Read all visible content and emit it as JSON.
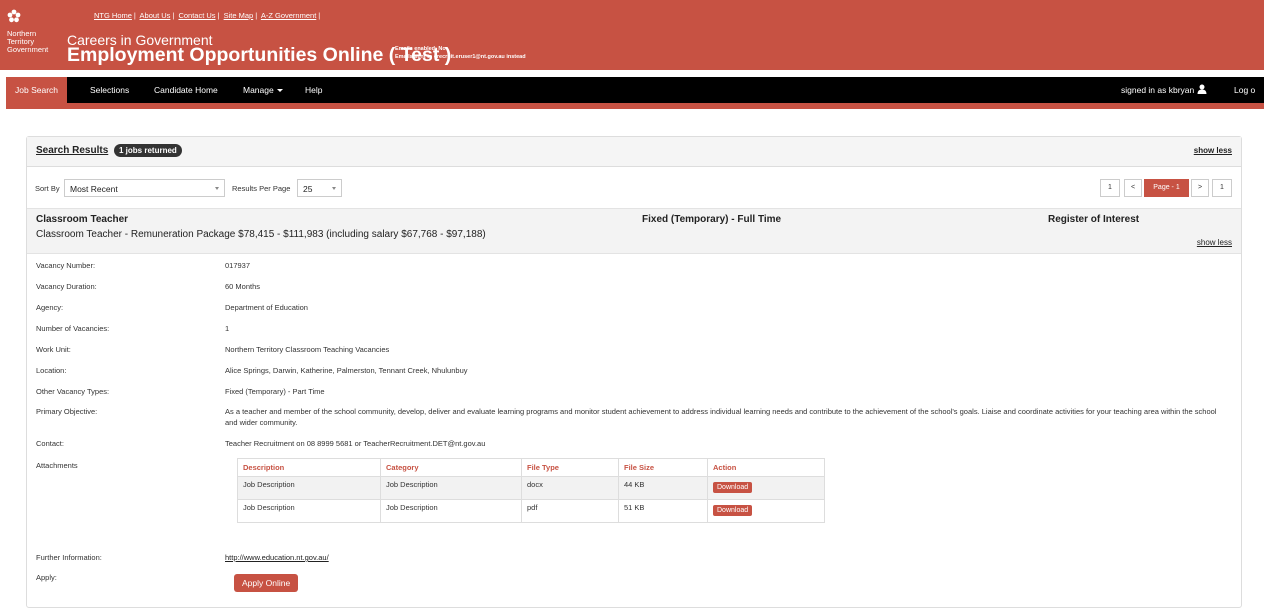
{
  "header": {
    "logo_text": [
      "Northern",
      "Territory",
      "Government"
    ],
    "top_links": [
      "NTG Home",
      "About Us",
      "Contact Us",
      "Site Map",
      "A-Z Government"
    ],
    "careers": "Careers in Government",
    "title": "Employment Opportunities Online ( Test )",
    "emails_line1": "Emails enabled: No",
    "emails_line2": "Emails sent to erecruit.eruser1@nt.gov.au instead"
  },
  "nav": {
    "items": [
      "Job Search",
      "Selections",
      "Candidate Home",
      "Manage",
      "Help"
    ],
    "signed_in": "signed in as kbryan",
    "logout": "Log o"
  },
  "results": {
    "title": "Search Results",
    "badge": "1 jobs returned",
    "show_less": "show less",
    "sort_label": "Sort By",
    "sort_value": "Most Recent",
    "per_page_label": "Results Per Page",
    "per_page_value": "25",
    "pagination": [
      "1",
      "<",
      "Page - 1",
      ">",
      "1"
    ]
  },
  "job": {
    "title": "Classroom Teacher",
    "subtitle": "Classroom Teacher - Remuneration Package $78,415 - $111,983 (including salary $67,768 - $97,188)",
    "type": "Fixed (Temporary) - Full Time",
    "roi": "Register of Interest",
    "show_less": "show less",
    "fields": [
      {
        "label": "Vacancy Number:",
        "value": "017937"
      },
      {
        "label": "Vacancy Duration:",
        "value": "60 Months"
      },
      {
        "label": "Agency:",
        "value": "Department of Education"
      },
      {
        "label": "Number of Vacancies:",
        "value": "1"
      },
      {
        "label": "Work Unit:",
        "value": "Northern Territory Classroom Teaching Vacancies"
      },
      {
        "label": "Location:",
        "value": "Alice Springs, Darwin, Katherine, Palmerston, Tennant Creek, Nhulunbuy"
      },
      {
        "label": "Other Vacancy Types:",
        "value": "Fixed (Temporary) - Part Time"
      },
      {
        "label": "Primary Objective:",
        "value": "As a teacher and member of the school community, develop, deliver and evaluate learning programs and monitor student achievement to address individual learning needs and contribute to the achievement of the school's goals. Liaise and coordinate activities for your teaching area within the school and wider community."
      },
      {
        "label": "Contact:",
        "value": "Teacher Recruitment on 08 8999 5681 or TeacherRecruitment.DET@nt.gov.au"
      }
    ],
    "attachments_label": "Attachments",
    "attachments_headers": [
      "Description",
      "Category",
      "File Type",
      "File Size",
      "Action"
    ],
    "attachments": [
      {
        "description": "Job Description",
        "category": "Job Description",
        "type": "docx",
        "size": "44 KB",
        "action": "Download"
      },
      {
        "description": "Job Description",
        "category": "Job Description",
        "type": "pdf",
        "size": "51 KB",
        "action": "Download"
      }
    ],
    "further_info_label": "Further Information:",
    "further_info_link": "http://www.education.nt.gov.au/",
    "apply_label": "Apply:",
    "apply_button": "Apply Online"
  },
  "colors": {
    "brand": "#c75243",
    "nav_bg": "#000000"
  }
}
